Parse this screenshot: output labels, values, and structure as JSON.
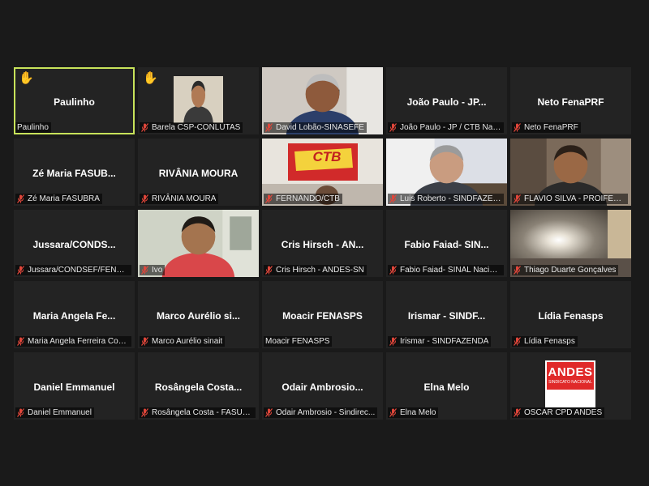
{
  "colors": {
    "background": "#1a1a1a",
    "tile": "#232323",
    "active_border": "#c8e35a",
    "muted_mic": "#e0463a",
    "hand": "#f4b400"
  },
  "tiles": [
    {
      "center": "Paulinho",
      "label": "Paulinho",
      "muted": false,
      "hand": true,
      "active": true
    },
    {
      "center": "",
      "label": "Barela CSP-CONLUTAS",
      "muted": true,
      "hand": true,
      "video": "barela"
    },
    {
      "center": "",
      "label": "David Lobão-SINASEFE",
      "muted": true,
      "video": "david"
    },
    {
      "center": "João Paulo - JP...",
      "label": "João Paulo - JP / CTB Naci...",
      "muted": true
    },
    {
      "center": "Neto FenaPRF",
      "label": "Neto FenaPRF",
      "muted": true
    },
    {
      "center": "Zé Maria FASUB...",
      "label": "Zé Maria FASUBRA",
      "muted": true
    },
    {
      "center": "RIVÂNIA MOURA",
      "label": "RIVÂNIA MOURA",
      "muted": true
    },
    {
      "center": "",
      "label": "FERNANDO/CTB",
      "muted": true,
      "video": "ctb",
      "logo_text": "CTB"
    },
    {
      "center": "",
      "label": "Luis Roberto - SINDFAZEN...",
      "muted": true,
      "video": "luis"
    },
    {
      "center": "",
      "label": "FLAVIO SILVA - PROIFES FE...",
      "muted": true,
      "video": "flavio"
    },
    {
      "center": "Jussara/CONDS...",
      "label": "Jussara/CONDSEF/FENADS...",
      "muted": true
    },
    {
      "center": "",
      "label": "Ivo",
      "muted": true,
      "video": "ivo"
    },
    {
      "center": "Cris Hirsch - AN...",
      "label": "Cris Hirsch - ANDES-SN",
      "muted": true
    },
    {
      "center": "Fabio Faiad- SIN...",
      "label": "Fabio Faiad- SINAL Nacional",
      "muted": true
    },
    {
      "center": "",
      "label": "Thiago Duarte Gonçalves",
      "muted": true,
      "video": "thiago"
    },
    {
      "center": "Maria Angela Fe...",
      "label": "Maria Angela Ferreira Costa",
      "muted": true
    },
    {
      "center": "Marco Aurélio si...",
      "label": "Marco Aurélio sinait",
      "muted": true
    },
    {
      "center": "Moacir FENASPS",
      "label": "Moacir FENASPS",
      "muted": false
    },
    {
      "center": "Irismar - SINDF...",
      "label": "Irismar - SINDFAZENDA",
      "muted": true
    },
    {
      "center": "Lídia Fenasps",
      "label": "Lídia Fenasps",
      "muted": true
    },
    {
      "center": "Daniel Emmanuel",
      "label": "Daniel Emmanuel",
      "muted": true
    },
    {
      "center": "Rosângela Costa...",
      "label": "Rosângela Costa - FASUBRA",
      "muted": true
    },
    {
      "center": "Odair Ambrosio...",
      "label": "Odair Ambrosio - Sindirec...",
      "muted": true
    },
    {
      "center": "Elna Melo",
      "label": "Elna Melo",
      "muted": true
    },
    {
      "center": "",
      "label": "OSCAR CPD ANDES",
      "muted": true,
      "video": "andes",
      "logo_text": "ANDES",
      "logo_sub": "SINDICATO NACIONAL"
    }
  ]
}
